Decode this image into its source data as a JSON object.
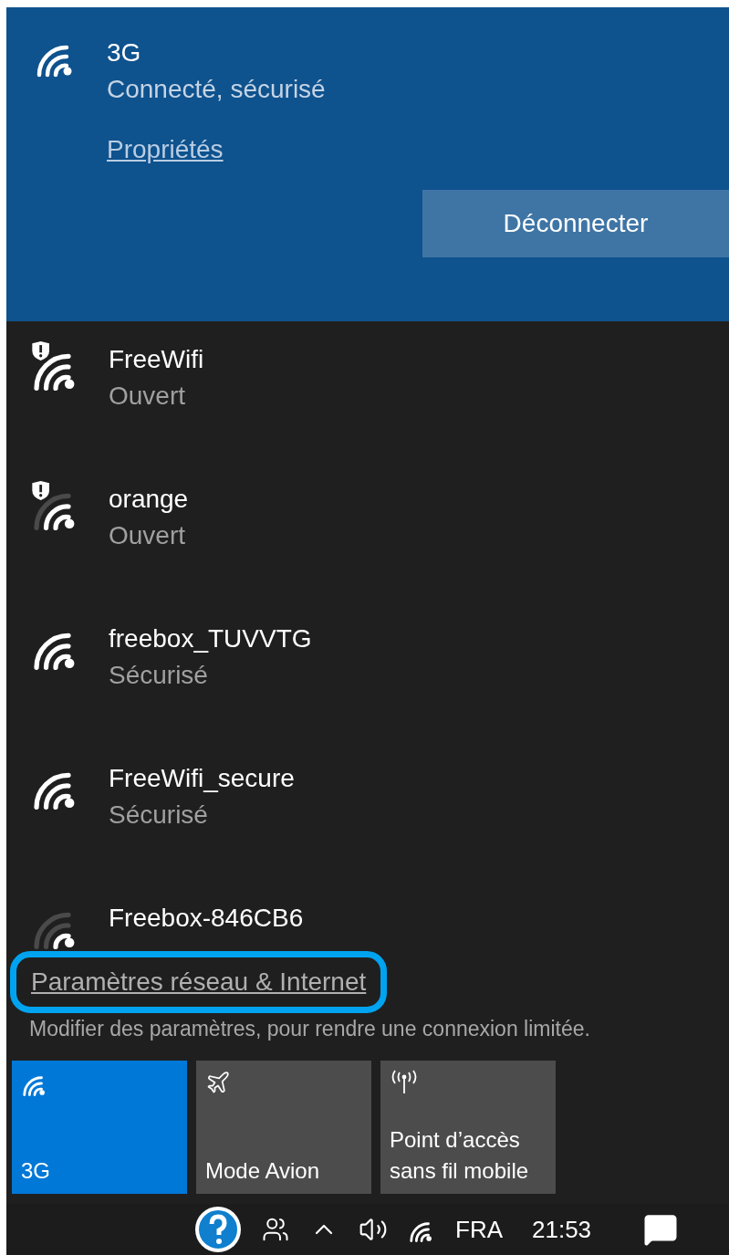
{
  "connected": {
    "name": "3G",
    "status": "Connecté, sécurisé",
    "properties_link": "Propriétés",
    "disconnect_button": "Déconnecter"
  },
  "networks": [
    {
      "name": "FreeWifi",
      "status": "Ouvert",
      "warning": true,
      "kind": "strong"
    },
    {
      "name": "orange",
      "status": "Ouvert",
      "warning": true,
      "kind": "medium"
    },
    {
      "name": "freebox_TUVVTG",
      "status": "Sécurisé",
      "warning": false,
      "kind": "strong"
    },
    {
      "name": "FreeWifi_secure",
      "status": "Sécurisé",
      "warning": false,
      "kind": "strong"
    },
    {
      "name": "Freebox-846CB6",
      "warning": false,
      "kind": "weak"
    }
  ],
  "settings_link": {
    "label": "Paramètres réseau & Internet",
    "highlighted": true
  },
  "settings_hint": "Modifier des paramètres, pour rendre une connexion limitée.",
  "quick_actions": [
    {
      "kind": "wifi",
      "label": "3G",
      "selected": true
    },
    {
      "kind": "airplane",
      "label": "Mode Avion",
      "selected": false
    },
    {
      "kind": "hotspot",
      "label": "Point d’accès sans fil mobile",
      "selected": false
    }
  ],
  "taskbar": {
    "language": "FRA",
    "time": "21:53"
  }
}
